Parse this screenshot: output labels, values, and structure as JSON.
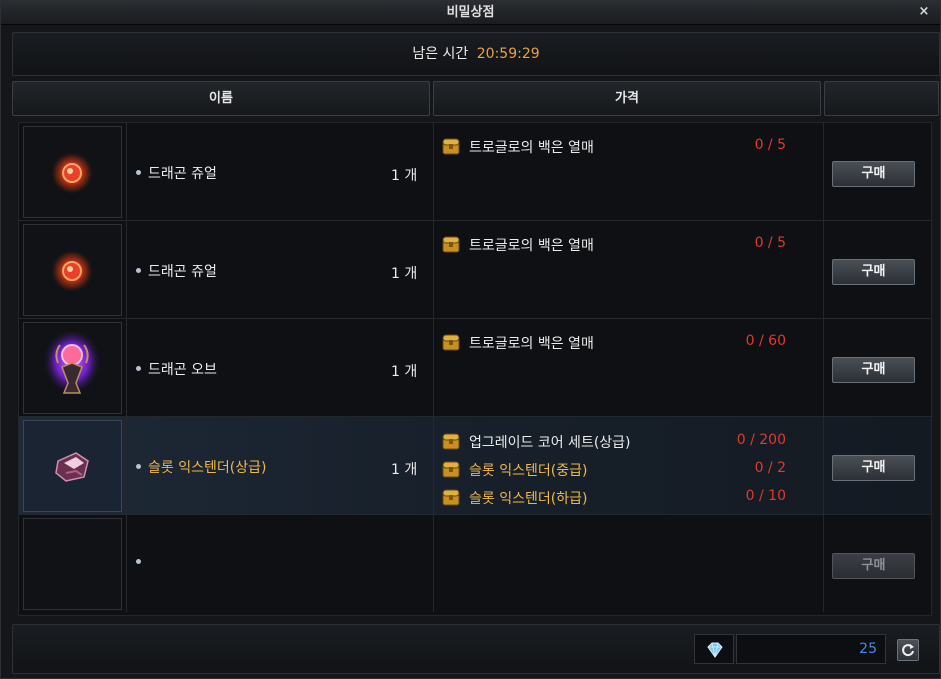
{
  "window": {
    "title": "비밀상점",
    "close_glyph": "×"
  },
  "timer": {
    "label": "남은 시간",
    "value": "20:59:29"
  },
  "headers": {
    "name": "이름",
    "price": "가격",
    "extra": ""
  },
  "rows": [
    {
      "item_icon": "dragon-jewel-icon",
      "item_name": "드래곤 쥬얼",
      "quantity": "1 개",
      "costs": [
        {
          "icon": "treasure-chest-icon",
          "name": "트로글로의 백은 열매",
          "count": "0 / 5"
        }
      ],
      "buy_label": "구매"
    },
    {
      "item_icon": "dragon-jewel-icon",
      "item_name": "드래곤 쥬얼",
      "quantity": "1 개",
      "costs": [
        {
          "icon": "treasure-chest-icon",
          "name": "트로글로의 백은 열매",
          "count": "0 / 5"
        }
      ],
      "buy_label": "구매"
    },
    {
      "item_icon": "dragon-orb-icon",
      "item_name": "드래곤 오브",
      "quantity": "1 개",
      "costs": [
        {
          "icon": "treasure-chest-icon",
          "name": "트로글로의 백은 열매",
          "count": "0 / 60"
        }
      ],
      "buy_label": "구매"
    },
    {
      "item_icon": "slot-extender-icon",
      "item_name": "슬롯 익스텐더(상급)",
      "quantity": "1 개",
      "costs": [
        {
          "icon": "treasure-chest-icon",
          "name": "업그레이드 코어 세트(상급)",
          "count": "0 / 200"
        },
        {
          "icon": "treasure-chest-icon",
          "name": "슬롯 익스텐더(중급)",
          "count": "0 / 2"
        },
        {
          "icon": "treasure-chest-icon",
          "name": "슬롯 익스텐더(하급)",
          "count": "0 / 10"
        }
      ],
      "buy_label": "구매"
    },
    {
      "item_icon": "",
      "item_name": "",
      "quantity": "",
      "costs": [],
      "buy_label": "구매"
    }
  ],
  "currency": {
    "icon": "diamond-icon",
    "value": "25",
    "refresh_icon": "refresh-icon"
  },
  "colors": {
    "timer": "#e9a244",
    "count_red": "#e03a2a",
    "gold_text": "#f0b84a",
    "currency_blue": "#3f8ee6"
  }
}
